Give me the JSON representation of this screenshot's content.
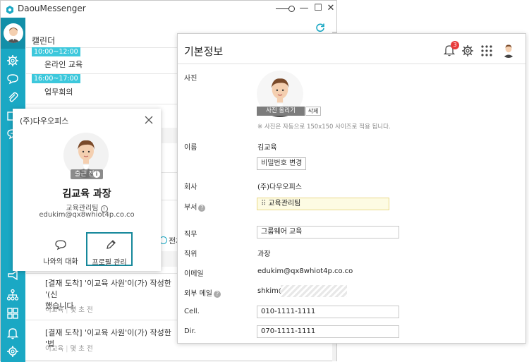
{
  "app": {
    "title": "DaouMessenger"
  },
  "window_controls": {
    "minimize": "—",
    "maximize": "☐",
    "close": "✕"
  },
  "calendar": {
    "title": "캘린더",
    "events": [
      {
        "time": "10:00~12:00",
        "title": "온라인 교육"
      },
      {
        "time": "16:00~17:00",
        "title": "업무회의"
      }
    ]
  },
  "notifications": {
    "all_read_label": "전체",
    "items": [
      {
        "line1": "[결재 도착] '이교육 사원'이(가) 작성한 '(신",
        "line2": "했습니다.",
        "author": "이교육",
        "time": "몇 초 전"
      },
      {
        "line1": "[결재 도착] '이교육 사원'이(가) 작성한 '법",
        "line2": "",
        "author": "이교육",
        "time": "몇 초 전"
      }
    ],
    "meta_separator": "|"
  },
  "profile_card": {
    "company": "(주)다우오피스",
    "status": "출근 전",
    "name": "김교육 과장",
    "department": "교육관리팀",
    "email": "edukim@qx8whiot4p.co.co",
    "chat_button": "나와의 대화",
    "edit_button": "프로필 관리"
  },
  "info_panel": {
    "title": "기본정보",
    "notification_count": "3",
    "photo": {
      "label": "사진",
      "change_button": "사진 올리기",
      "delete_button": "삭제",
      "note": "※ 사진은 자동으로 150x150 사이즈로 적용 됩니다."
    },
    "fields": {
      "name_label": "이름",
      "name_value": "김교육",
      "password_button": "비밀번호 변경",
      "company_label": "회사",
      "company_value": "(주)다우오피스",
      "dept_label": "부서",
      "dept_value": "교육관리팀",
      "duty_label": "직무",
      "duty_value": "그룹웨어 교육",
      "position_label": "직위",
      "position_value": "과장",
      "email_label": "이메일",
      "email_value": "edukim@qx8whiot4p.co.co",
      "ext_mail_label": "외부 메일",
      "ext_mail_value": "shkim@",
      "cell_label": "Cell.",
      "cell_value": "010-1111-1111",
      "dir_label": "Dir.",
      "dir_value": "070-1111-1111"
    }
  },
  "colors": {
    "sidebar": "#1aa8c4",
    "accent": "#3dc8dc",
    "badge": "#e83b3b"
  },
  "icons": [
    "app-logo-icon",
    "gear-icon",
    "chat-bubble-icon",
    "paperclip-icon",
    "megaphone-icon",
    "org-chart-icon",
    "grid-icon",
    "bell-icon",
    "settings-icon",
    "refresh-icon",
    "close-icon",
    "pencil-icon",
    "apps-icon",
    "help-icon"
  ]
}
